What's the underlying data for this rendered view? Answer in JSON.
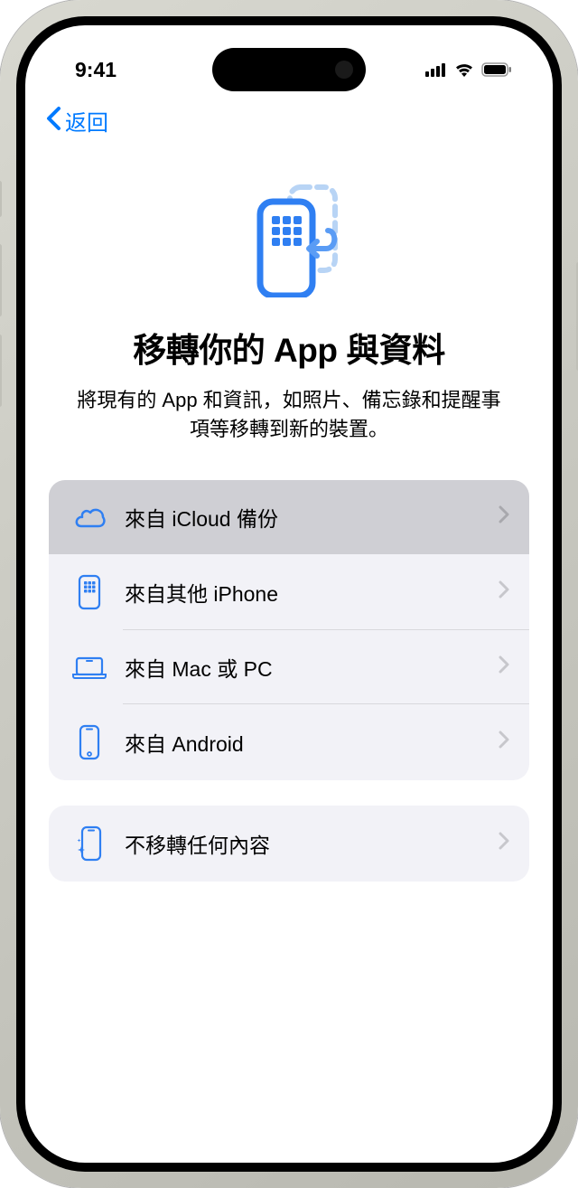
{
  "status": {
    "time": "9:41"
  },
  "nav": {
    "back_label": "返回"
  },
  "header": {
    "title": "移轉你的 App 與資料",
    "subtitle": "將現有的 App 和資訊，如照片、備忘錄和提醒事項等移轉到新的裝置。"
  },
  "options_primary": [
    {
      "label": "來自 iCloud 備份",
      "icon": "cloud",
      "highlighted": true
    },
    {
      "label": "來自其他 iPhone",
      "icon": "iphone-apps",
      "highlighted": false
    },
    {
      "label": "來自 Mac 或 PC",
      "icon": "laptop",
      "highlighted": false
    },
    {
      "label": "來自 Android",
      "icon": "phone",
      "highlighted": false
    }
  ],
  "options_secondary": [
    {
      "label": "不移轉任何內容",
      "icon": "phone-sparkle"
    }
  ],
  "colors": {
    "accent": "#007aff",
    "list_bg": "#f2f2f7",
    "highlight_bg": "#cfcfd4",
    "chevron": "#c7c7cc"
  }
}
